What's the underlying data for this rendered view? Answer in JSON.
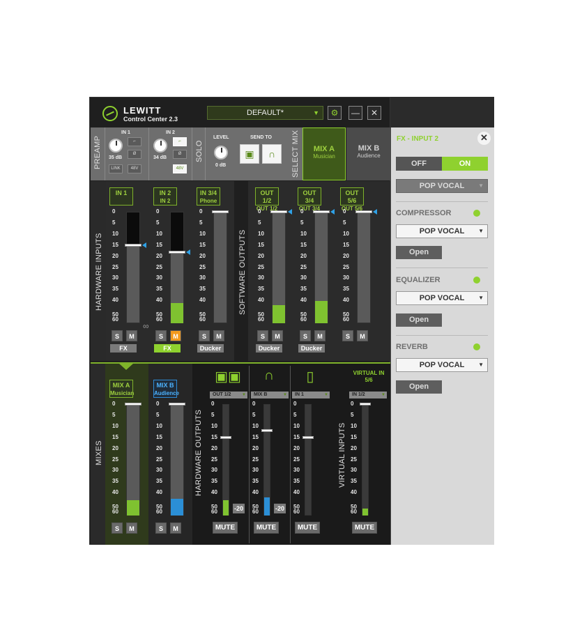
{
  "app": {
    "brand": "LEWITT",
    "subtitle": "Control Center",
    "version": "2.3",
    "preset": "DEFAULT*"
  },
  "header_buttons": {
    "settings": "⚙",
    "minimize": "—",
    "close": "✕"
  },
  "preamp": {
    "label": "PREAMP",
    "in1": {
      "title": "IN 1",
      "gain": "35 dB",
      "link": "LINK",
      "phantom": "48V"
    },
    "in2": {
      "title": "IN 2",
      "gain": "34 dB",
      "phantom": "48V"
    },
    "solo": "SOLO",
    "level": {
      "title": "LEVEL",
      "value": "0 dB"
    },
    "send_to": "SEND TO"
  },
  "select_mix": {
    "label": "SELECT MIX",
    "mix_a": "MIX A",
    "mix_a_sub": "Musician",
    "mix_b": "MIX B",
    "mix_b_sub": "Audience"
  },
  "sections": {
    "hardware_inputs": "HARDWARE INPUTS",
    "software_outputs": "SOFTWARE OUTPUTS",
    "mixes": "MIXES",
    "hardware_outputs": "HARDWARE OUTPUTS",
    "virtual_inputs": "VIRTUAL INPUTS"
  },
  "scale": [
    "0",
    "5",
    "10",
    "15",
    "20",
    "25",
    "30",
    "35",
    "40",
    "50",
    "60"
  ],
  "inputs": [
    {
      "l1": "IN 1",
      "l2": "",
      "tag": "FX",
      "s": "S",
      "m": "M",
      "fader": 15,
      "meter": 0
    },
    {
      "l1": "IN 2",
      "l2": "IN 2",
      "tag": "FX",
      "s": "S",
      "m": "M",
      "fader": 18,
      "meter": 0.18
    },
    {
      "l1": "IN 3/4",
      "l2": "Phone",
      "tag": "Ducker",
      "s": "S",
      "m": "M",
      "fader": 0,
      "meter": 0
    }
  ],
  "software_outputs": [
    {
      "l1": "OUT 1/2",
      "l2": "OUT 1/2",
      "tag": "Ducker",
      "s": "S",
      "m": "M",
      "fader": 0,
      "meter": 0.16
    },
    {
      "l1": "OUT 3/4",
      "l2": "OUT 3/4",
      "tag": "Ducker",
      "s": "S",
      "m": "M",
      "fader": 0,
      "meter": 0.2
    },
    {
      "l1": "OUT 5/6",
      "l2": "OUT 5/6",
      "s": "S",
      "m": "M",
      "fader": 0,
      "meter": 0
    }
  ],
  "mixes": [
    {
      "l1": "MIX A",
      "l2": "Musician",
      "s": "S",
      "m": "M",
      "meter": 0.14
    },
    {
      "l1": "MIX B",
      "l2": "Audience",
      "s": "S",
      "m": "M",
      "meter": 0.15
    }
  ],
  "hw_outputs": [
    {
      "source": "OUT 1/2",
      "neg": "-20",
      "mute": "MUTE"
    },
    {
      "source": "MIX B",
      "neg": "-20",
      "mute": "MUTE"
    },
    {
      "source": "IN 1",
      "mute": "MUTE"
    }
  ],
  "virtual_in": {
    "title": "VIRTUAL IN 5/6",
    "source": "IN 1/2",
    "mute": "MUTE"
  },
  "fx": {
    "title": "FX - INPUT 2",
    "off": "OFF",
    "on": "ON",
    "preset": "POP VOCAL",
    "compressor": {
      "title": "COMPRESSOR",
      "preset": "POP VOCAL",
      "open": "Open"
    },
    "equalizer": {
      "title": "EQUALIZER",
      "preset": "POP VOCAL",
      "open": "Open"
    },
    "reverb": {
      "title": "REVERB",
      "preset": "POP VOCAL",
      "open": "Open"
    }
  },
  "colors": {
    "accent_green": "#8fd12f",
    "accent_blue": "#2b8fd6",
    "solo_orange": "#f39a1e"
  }
}
